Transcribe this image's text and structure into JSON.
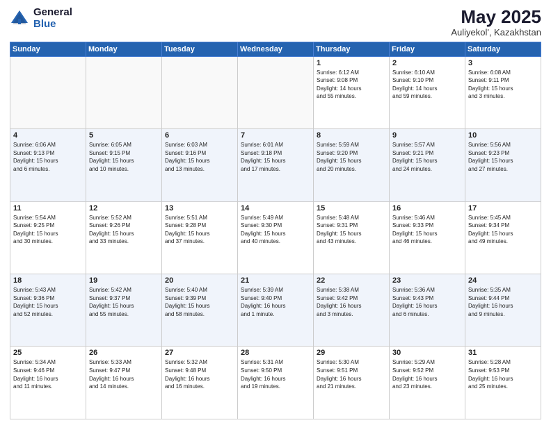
{
  "header": {
    "logo_general": "General",
    "logo_blue": "Blue",
    "month_year": "May 2025",
    "location": "Auliyekol', Kazakhstan"
  },
  "weekdays": [
    "Sunday",
    "Monday",
    "Tuesday",
    "Wednesday",
    "Thursday",
    "Friday",
    "Saturday"
  ],
  "weeks": [
    [
      {
        "day": "",
        "info": ""
      },
      {
        "day": "",
        "info": ""
      },
      {
        "day": "",
        "info": ""
      },
      {
        "day": "",
        "info": ""
      },
      {
        "day": "1",
        "info": "Sunrise: 6:12 AM\nSunset: 9:08 PM\nDaylight: 14 hours\nand 55 minutes."
      },
      {
        "day": "2",
        "info": "Sunrise: 6:10 AM\nSunset: 9:10 PM\nDaylight: 14 hours\nand 59 minutes."
      },
      {
        "day": "3",
        "info": "Sunrise: 6:08 AM\nSunset: 9:11 PM\nDaylight: 15 hours\nand 3 minutes."
      }
    ],
    [
      {
        "day": "4",
        "info": "Sunrise: 6:06 AM\nSunset: 9:13 PM\nDaylight: 15 hours\nand 6 minutes."
      },
      {
        "day": "5",
        "info": "Sunrise: 6:05 AM\nSunset: 9:15 PM\nDaylight: 15 hours\nand 10 minutes."
      },
      {
        "day": "6",
        "info": "Sunrise: 6:03 AM\nSunset: 9:16 PM\nDaylight: 15 hours\nand 13 minutes."
      },
      {
        "day": "7",
        "info": "Sunrise: 6:01 AM\nSunset: 9:18 PM\nDaylight: 15 hours\nand 17 minutes."
      },
      {
        "day": "8",
        "info": "Sunrise: 5:59 AM\nSunset: 9:20 PM\nDaylight: 15 hours\nand 20 minutes."
      },
      {
        "day": "9",
        "info": "Sunrise: 5:57 AM\nSunset: 9:21 PM\nDaylight: 15 hours\nand 24 minutes."
      },
      {
        "day": "10",
        "info": "Sunrise: 5:56 AM\nSunset: 9:23 PM\nDaylight: 15 hours\nand 27 minutes."
      }
    ],
    [
      {
        "day": "11",
        "info": "Sunrise: 5:54 AM\nSunset: 9:25 PM\nDaylight: 15 hours\nand 30 minutes."
      },
      {
        "day": "12",
        "info": "Sunrise: 5:52 AM\nSunset: 9:26 PM\nDaylight: 15 hours\nand 33 minutes."
      },
      {
        "day": "13",
        "info": "Sunrise: 5:51 AM\nSunset: 9:28 PM\nDaylight: 15 hours\nand 37 minutes."
      },
      {
        "day": "14",
        "info": "Sunrise: 5:49 AM\nSunset: 9:30 PM\nDaylight: 15 hours\nand 40 minutes."
      },
      {
        "day": "15",
        "info": "Sunrise: 5:48 AM\nSunset: 9:31 PM\nDaylight: 15 hours\nand 43 minutes."
      },
      {
        "day": "16",
        "info": "Sunrise: 5:46 AM\nSunset: 9:33 PM\nDaylight: 15 hours\nand 46 minutes."
      },
      {
        "day": "17",
        "info": "Sunrise: 5:45 AM\nSunset: 9:34 PM\nDaylight: 15 hours\nand 49 minutes."
      }
    ],
    [
      {
        "day": "18",
        "info": "Sunrise: 5:43 AM\nSunset: 9:36 PM\nDaylight: 15 hours\nand 52 minutes."
      },
      {
        "day": "19",
        "info": "Sunrise: 5:42 AM\nSunset: 9:37 PM\nDaylight: 15 hours\nand 55 minutes."
      },
      {
        "day": "20",
        "info": "Sunrise: 5:40 AM\nSunset: 9:39 PM\nDaylight: 15 hours\nand 58 minutes."
      },
      {
        "day": "21",
        "info": "Sunrise: 5:39 AM\nSunset: 9:40 PM\nDaylight: 16 hours\nand 1 minute."
      },
      {
        "day": "22",
        "info": "Sunrise: 5:38 AM\nSunset: 9:42 PM\nDaylight: 16 hours\nand 3 minutes."
      },
      {
        "day": "23",
        "info": "Sunrise: 5:36 AM\nSunset: 9:43 PM\nDaylight: 16 hours\nand 6 minutes."
      },
      {
        "day": "24",
        "info": "Sunrise: 5:35 AM\nSunset: 9:44 PM\nDaylight: 16 hours\nand 9 minutes."
      }
    ],
    [
      {
        "day": "25",
        "info": "Sunrise: 5:34 AM\nSunset: 9:46 PM\nDaylight: 16 hours\nand 11 minutes."
      },
      {
        "day": "26",
        "info": "Sunrise: 5:33 AM\nSunset: 9:47 PM\nDaylight: 16 hours\nand 14 minutes."
      },
      {
        "day": "27",
        "info": "Sunrise: 5:32 AM\nSunset: 9:48 PM\nDaylight: 16 hours\nand 16 minutes."
      },
      {
        "day": "28",
        "info": "Sunrise: 5:31 AM\nSunset: 9:50 PM\nDaylight: 16 hours\nand 19 minutes."
      },
      {
        "day": "29",
        "info": "Sunrise: 5:30 AM\nSunset: 9:51 PM\nDaylight: 16 hours\nand 21 minutes."
      },
      {
        "day": "30",
        "info": "Sunrise: 5:29 AM\nSunset: 9:52 PM\nDaylight: 16 hours\nand 23 minutes."
      },
      {
        "day": "31",
        "info": "Sunrise: 5:28 AM\nSunset: 9:53 PM\nDaylight: 16 hours\nand 25 minutes."
      }
    ]
  ]
}
